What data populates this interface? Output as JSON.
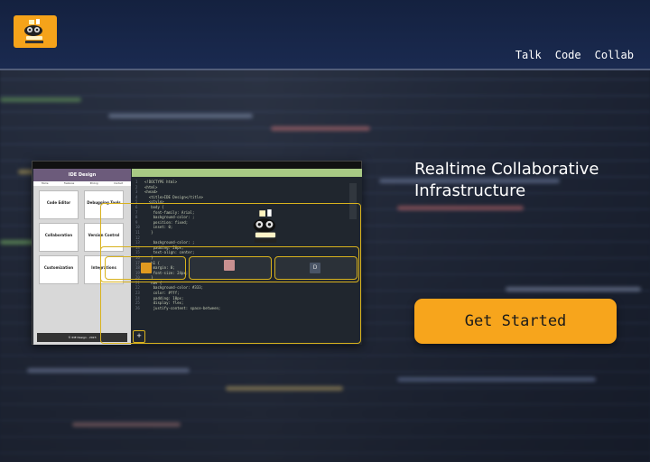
{
  "header": {
    "logo_icon": "robot-mascot-icon",
    "accent_color": "#f5a31a",
    "nav": [
      {
        "label": "Talk"
      },
      {
        "label": "Code"
      },
      {
        "label": "Collab"
      }
    ]
  },
  "hero": {
    "title_line1": "Realtime Collaborative",
    "title_line2": "Infrastructure",
    "cta_label": "Get Started"
  },
  "preview": {
    "page_title": "IDE Design",
    "page_nav": [
      "Home",
      "Features",
      "Pricing",
      "Contact"
    ],
    "cards": [
      {
        "title": "Code Editor"
      },
      {
        "title": "Debugging Tools"
      },
      {
        "title": "Collaboration"
      },
      {
        "title": "Version Control"
      },
      {
        "title": "Customization"
      },
      {
        "title": "Integrations"
      }
    ],
    "footer": "© IDE Design - 2023",
    "user_badge": "D",
    "plus": "+"
  }
}
